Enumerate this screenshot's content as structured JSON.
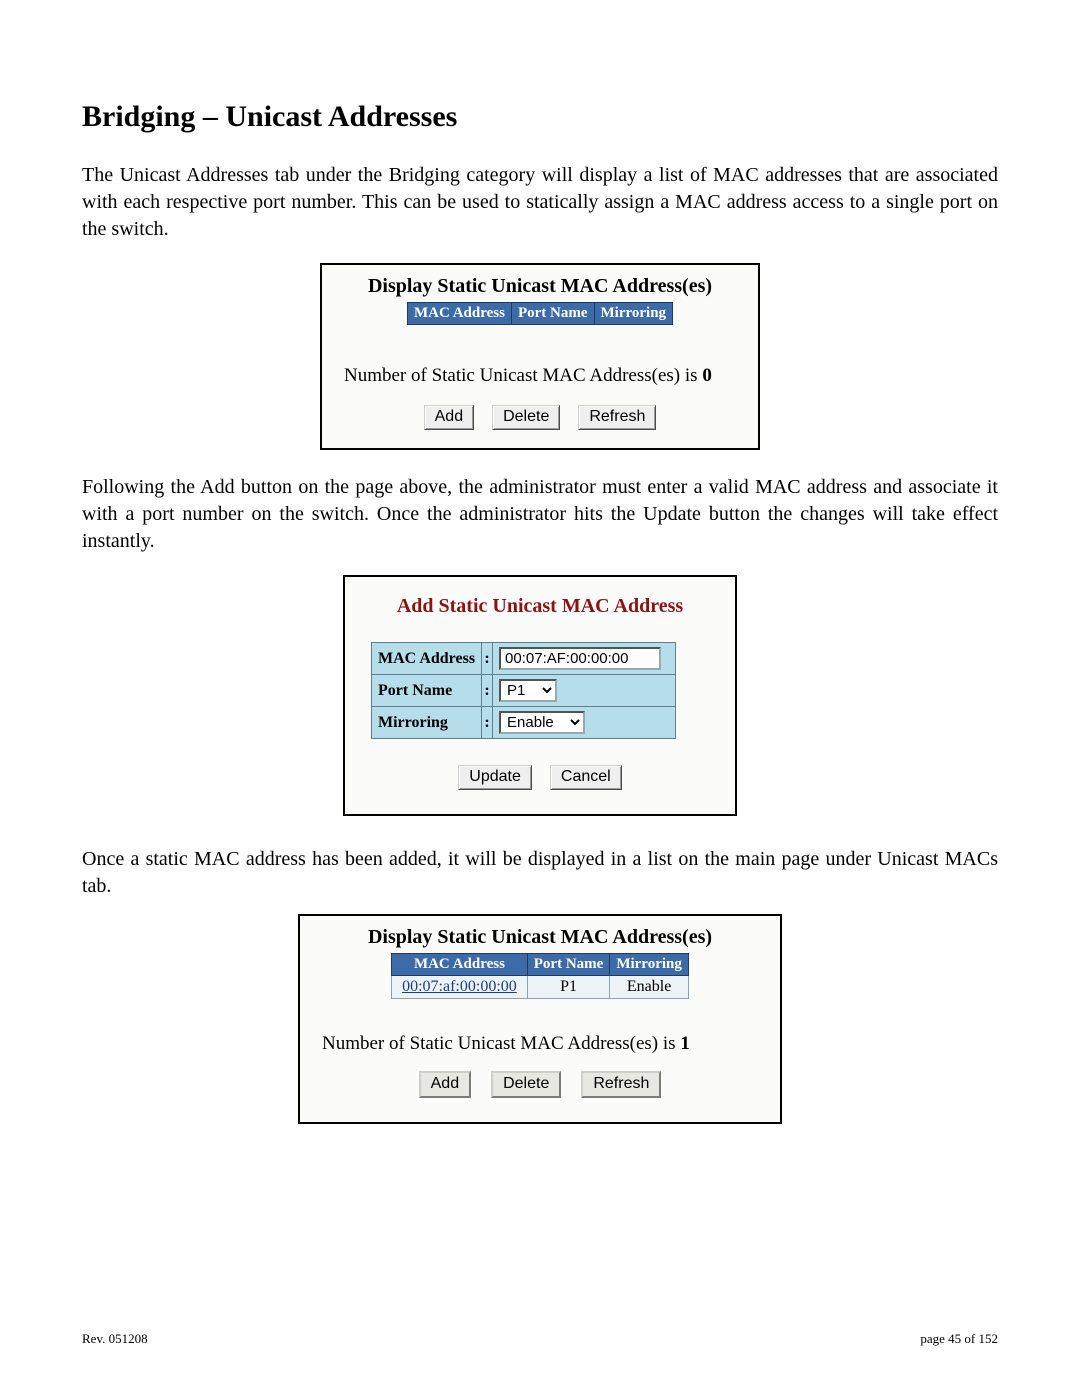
{
  "title": "Bridging – Unicast Addresses",
  "para1": "The Unicast Addresses tab under the Bridging category will display a list of MAC addresses that are associated with each respective port number.  This can be used to statically assign a MAC address access to a single port on the switch.",
  "para2": "Following the Add button on the page above, the administrator must enter a valid MAC address and associate it with a port number on the switch.  Once the administrator hits the Update button the changes will take effect instantly.",
  "para3": "Once a static MAC address has been added, it will be displayed in a list on the main page under Unicast MACs tab.",
  "panel1": {
    "title": "Display Static Unicast MAC Address(es)",
    "headers": [
      "MAC Address",
      "Port Name",
      "Mirroring"
    ],
    "count_prefix": "Number of Static Unicast MAC Address(es) is ",
    "count_value": "0",
    "buttons": {
      "add": "Add",
      "delete": "Delete",
      "refresh": "Refresh"
    }
  },
  "panel2": {
    "title": "Add Static Unicast MAC Address",
    "rows": {
      "mac": {
        "label": "MAC Address",
        "value": "00:07:AF:00:00:00"
      },
      "port": {
        "label": "Port Name",
        "value": "P1"
      },
      "mirr": {
        "label": "Mirroring",
        "value": "Enable"
      }
    },
    "sep": ":",
    "buttons": {
      "update": "Update",
      "cancel": "Cancel"
    }
  },
  "panel3": {
    "title": "Display Static Unicast MAC Address(es)",
    "headers": [
      "MAC Address",
      "Port Name",
      "Mirroring"
    ],
    "row": {
      "mac": "00:07:af:00:00:00",
      "port": "P1",
      "mirr": "Enable"
    },
    "count_prefix": "Number of Static Unicast MAC Address(es) is ",
    "count_value": "1",
    "buttons": {
      "add": "Add",
      "delete": "Delete",
      "refresh": "Refresh"
    }
  },
  "footer": {
    "left": "Rev.  051208",
    "right": "page 45 of 152"
  }
}
